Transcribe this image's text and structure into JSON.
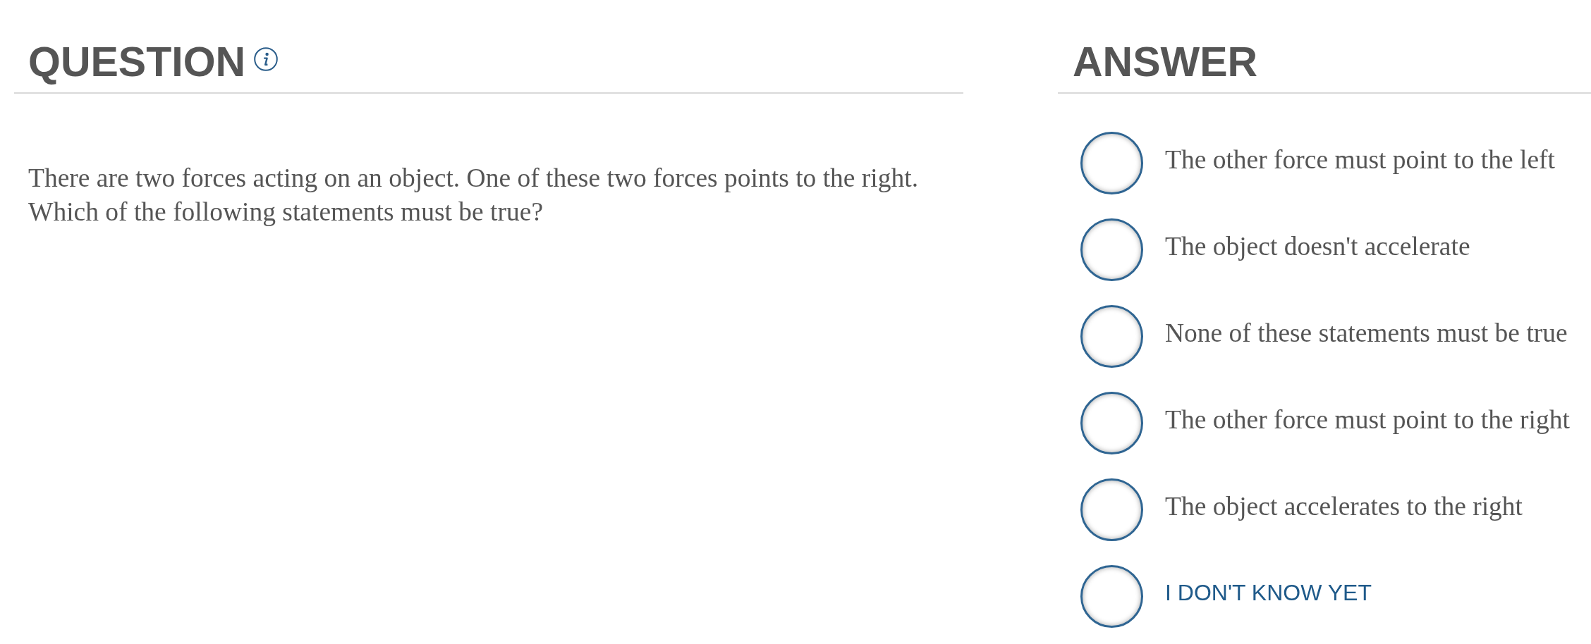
{
  "question": {
    "heading": "QUESTION",
    "text": "There are two forces acting on an object. One of these two forces points to the right.\nWhich of the following statements must be true?"
  },
  "answer": {
    "heading": "ANSWER",
    "options": [
      {
        "label": "The other force must point to the left",
        "kind": "statement",
        "selected": false
      },
      {
        "label": "The object doesn't accelerate",
        "kind": "statement",
        "selected": false
      },
      {
        "label": "None of these statements must be true",
        "kind": "statement",
        "selected": false
      },
      {
        "label": "The other force must point to the right",
        "kind": "statement",
        "selected": false
      },
      {
        "label": "The object accelerates to the right",
        "kind": "statement",
        "selected": false
      },
      {
        "label": "I DON'T KNOW YET",
        "kind": "unsure",
        "selected": false
      }
    ]
  }
}
